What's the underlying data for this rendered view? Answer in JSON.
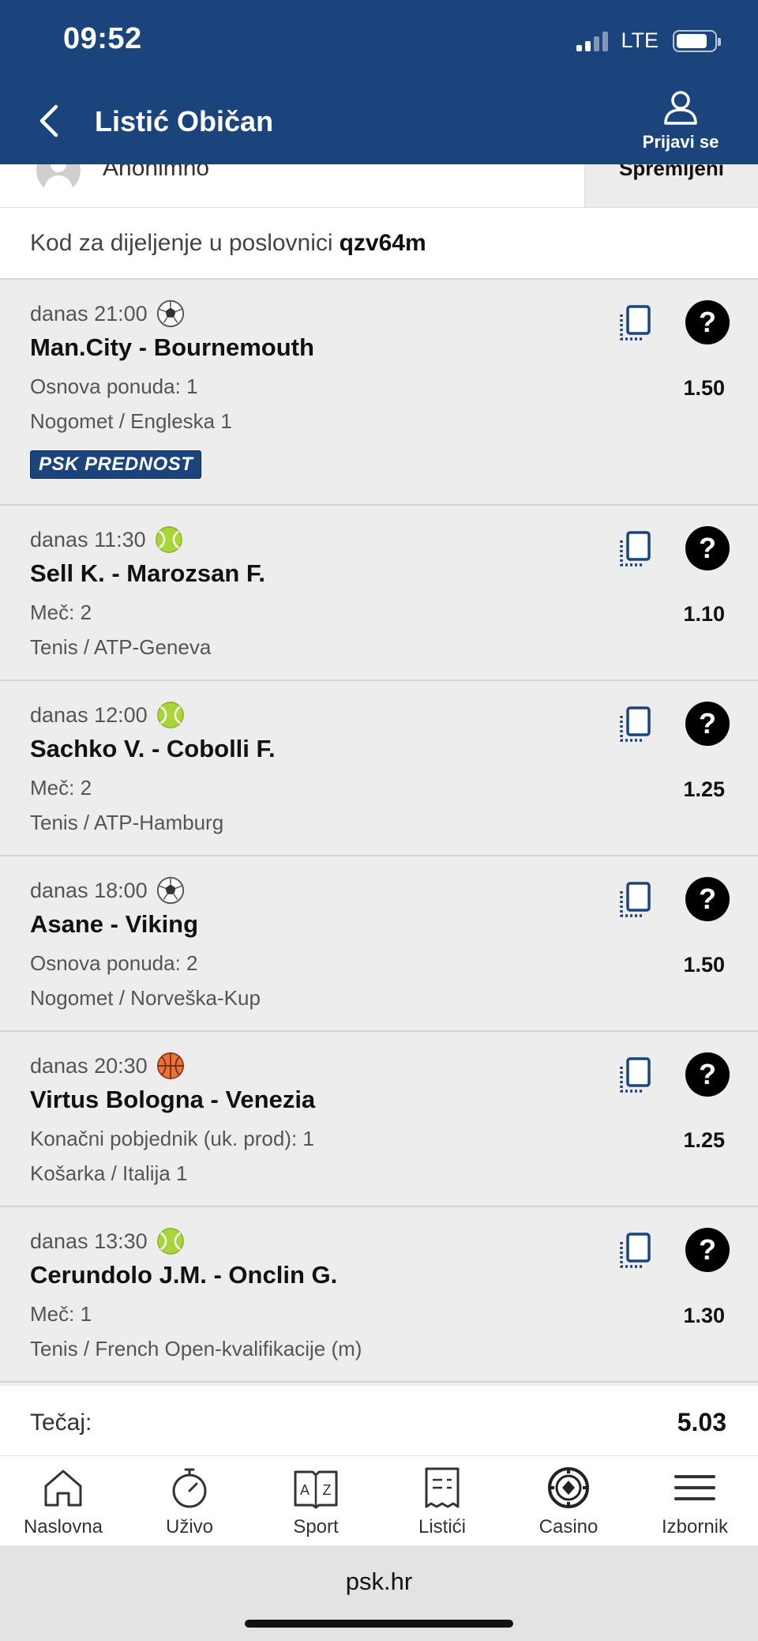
{
  "status_bar": {
    "time": "09:52",
    "network": "LTE"
  },
  "header": {
    "title": "Listić Običan",
    "login_label": "Prijavi se"
  },
  "user": {
    "name": "Anonimno",
    "saved_tab": "Spremljeni"
  },
  "share": {
    "label": "Kod za dijeljenje u poslovnici",
    "code": "qzv64m"
  },
  "bets": [
    {
      "time": "danas 21:00",
      "sport_icon": "football-icon",
      "match": "Man.City - Bournemouth",
      "market": "Osnova ponuda: 1",
      "league": "Nogomet / Engleska 1",
      "odd": "1.50",
      "badge": "PSK PREDNOST"
    },
    {
      "time": "danas 11:30",
      "sport_icon": "tennis-icon",
      "match": "Sell K. - Marozsan F.",
      "market": "Meč: 2",
      "league": "Tenis / ATP-Geneva",
      "odd": "1.10"
    },
    {
      "time": "danas 12:00",
      "sport_icon": "tennis-icon",
      "match": "Sachko V. - Cobolli F.",
      "market": "Meč: 2",
      "league": "Tenis / ATP-Hamburg",
      "odd": "1.25"
    },
    {
      "time": "danas 18:00",
      "sport_icon": "football-icon",
      "match": "Asane - Viking",
      "market": "Osnova ponuda: 2",
      "league": "Nogomet / Norveška-Kup",
      "odd": "1.50"
    },
    {
      "time": "danas 20:30",
      "sport_icon": "basketball-icon",
      "match": "Virtus Bologna - Venezia",
      "market": "Konačni pobjednik (uk. prod): 1",
      "league": "Košarka / Italija 1",
      "odd": "1.25"
    },
    {
      "time": "danas 13:30",
      "sport_icon": "tennis-icon",
      "match": "Cerundolo J.M. - Onclin G.",
      "market": "Meč: 1",
      "league": "Tenis / French Open-kvalifikacije (m)",
      "odd": "1.30"
    }
  ],
  "help_symbol": "?",
  "total": {
    "label": "Tečaj:",
    "value": "5.03"
  },
  "nav": [
    {
      "label": "Naslovna",
      "icon": "home-icon"
    },
    {
      "label": "Uživo",
      "icon": "stopwatch-icon"
    },
    {
      "label": "Sport",
      "icon": "sport-book-icon"
    },
    {
      "label": "Listići",
      "icon": "ticket-icon"
    },
    {
      "label": "Casino",
      "icon": "casino-chip-icon"
    },
    {
      "label": "Izbornik",
      "icon": "menu-icon"
    }
  ],
  "browser": {
    "url": "psk.hr"
  },
  "colors": {
    "header_bg": "#1a447b",
    "badge_bg": "#1a447b",
    "copy_icon": "#1a447b"
  }
}
